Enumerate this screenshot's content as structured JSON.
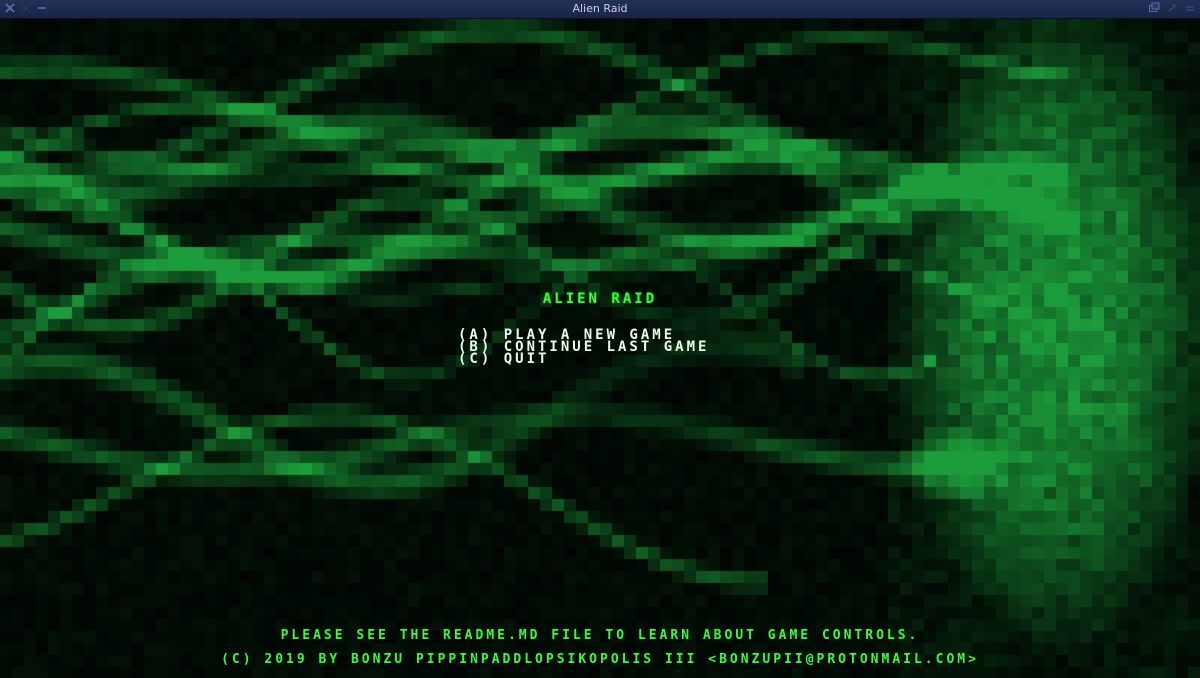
{
  "window": {
    "title": "Alien Raid"
  },
  "game": {
    "title": "ALIEN RAID",
    "menu": [
      {
        "label": "(A) PLAY A NEW GAME"
      },
      {
        "label": "(B) CONTINUE LAST GAME"
      },
      {
        "label": "(C) QUIT"
      }
    ],
    "footer_line1": "PLEASE SEE THE README.MD FILE TO LEARN ABOUT GAME CONTROLS.",
    "footer_line2": "(C) 2019 BY BONZU PIPPINPADDLOPSIKOPOLIS III <BONZUPII@PROTONMAIL.COM>"
  },
  "colors": {
    "accent_green": "#33ff33",
    "menu_text": "#e8ffe8",
    "titlebar": "#1a2446"
  },
  "icons": {
    "titlebar_left": [
      "close-icon",
      "maximize-icon",
      "minimize-icon"
    ],
    "titlebar_right": [
      "restore-icon",
      "pin-icon",
      "menu-icon"
    ]
  }
}
